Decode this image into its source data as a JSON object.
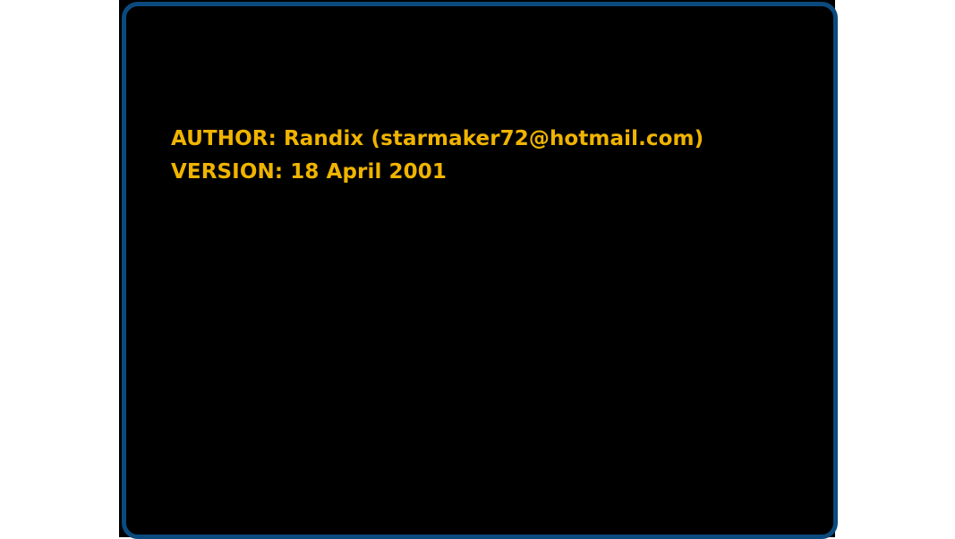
{
  "colors": {
    "frame_border": "#0b4a7e",
    "screen_background": "#000000",
    "text": "#f0b400",
    "outside_background": "#ffffff"
  },
  "credits": {
    "author_line": "AUTHOR: Randix (starmaker72@hotmail.com)",
    "version_line": "VERSION: 18 April 2001"
  }
}
